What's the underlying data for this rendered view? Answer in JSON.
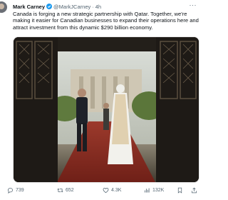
{
  "post": {
    "author_name": "Mark Carney",
    "author_handle": "@MarkJCarney",
    "separator": "·",
    "time": "4h",
    "more_label": "···",
    "text": "Canada is forging a new strategic partnership with Qatar. Together, we're making it easier for Canadian businesses to expand their operations here and attract investment from this dynamic $290 billion economy.",
    "verified_color": "#1d9bf0"
  },
  "actions": {
    "replies": "739",
    "reposts": "652",
    "likes": "4.3K",
    "views": "132K"
  },
  "icons": [
    "avatar",
    "verified-badge-icon",
    "more-icon",
    "reply-icon",
    "retweet-icon",
    "like-icon",
    "views-icon",
    "bookmark-icon",
    "share-icon"
  ]
}
